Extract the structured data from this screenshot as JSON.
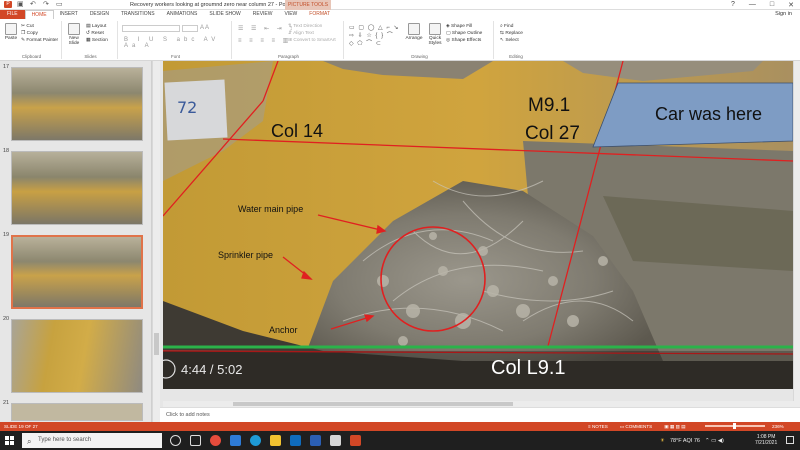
{
  "window": {
    "title": "Recovery workers looking at groumnd zero near column 27 - PowerPoint",
    "picture_tools": "PICTURE TOOLS",
    "signin": "Sign in",
    "controls": [
      "?",
      "—",
      "□",
      "✕"
    ]
  },
  "tabs": [
    "FILE",
    "HOME",
    "INSERT",
    "DESIGN",
    "TRANSITIONS",
    "ANIMATIONS",
    "SLIDE SHOW",
    "REVIEW",
    "VIEW",
    "FORMAT"
  ],
  "ribbon": {
    "clipboard": {
      "paste": "Paste",
      "cut": "Cut",
      "copy": "Copy",
      "format_painter": "Format Painter",
      "label": "Clipboard"
    },
    "slides": {
      "new_slide": "New Slide",
      "layout": "Layout",
      "reset": "Reset",
      "section": "Section",
      "label": "Slides"
    },
    "font": {
      "label": "Font"
    },
    "paragraph": {
      "text_direction": "Text Direction",
      "align_text": "Align Text",
      "convert_smartart": "Convert to SmartArt",
      "label": "Paragraph"
    },
    "drawing": {
      "arrange": "Arrange",
      "quick_styles": "Quick Styles",
      "shape_fill": "Shape Fill",
      "shape_outline": "Shape Outline",
      "shape_effects": "Shape Effects",
      "label": "Drawing"
    },
    "editing": {
      "find": "Find",
      "replace": "Replace",
      "select": "Select",
      "label": "Editing"
    }
  },
  "thumbnails": [
    {
      "num": "17",
      "selected": false
    },
    {
      "num": "18",
      "selected": false
    },
    {
      "num": "19",
      "selected": true
    },
    {
      "num": "20",
      "selected": false
    },
    {
      "num": "21",
      "selected": false
    }
  ],
  "slide": {
    "labels": {
      "col14": "Col 14",
      "m91": "M9.1",
      "col27": "Col 27",
      "car": "Car was here",
      "water": "Water main pipe",
      "sprinkler": "Sprinkler pipe",
      "anchor": "Anchor",
      "coll91": "Col L9.1",
      "time": "4:44 / 5:02",
      "sign": "72"
    },
    "colors": {
      "red": "#e02020",
      "green": "#2bb34a",
      "blue": "#7e9cc4"
    }
  },
  "notes_placeholder": "Click to add notes",
  "status": {
    "slide_info": "SLIDE 19 OF 27",
    "notes": "NOTES",
    "comments": "COMMENTS",
    "zoom": "236%"
  },
  "taskbar": {
    "search_placeholder": "Type here to search",
    "weather": "78°F AQI 76",
    "time": "1:08 PM",
    "date": "7/21/2021"
  }
}
